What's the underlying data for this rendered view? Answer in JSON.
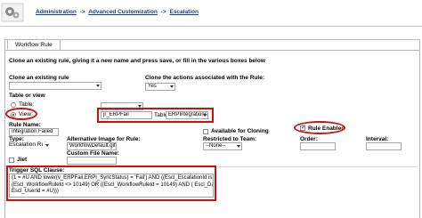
{
  "breadcrumb": {
    "item1": "Administration",
    "sep": "->",
    "item2": "Advanced Customization",
    "item3": "Escalation"
  },
  "tab": {
    "label": "Workflow Rule"
  },
  "form": {
    "clone_intro": "Clone an existing rule, giving it a new name and press save, or fill in the various boxes below",
    "clone_rule_label": "Clone an existing rule",
    "clone_actions_label": "Clone the actions associated with the Rule:",
    "clone_rule_value": "",
    "clone_actions_value": "Yes",
    "table_or_view_label": "Table or view",
    "table_radio_label": "Table:",
    "view_radio_label": "View:",
    "view_value": "jr_ERPFail",
    "table_label2": "Table:",
    "table_value2": "ERPIntegrations",
    "rule_name_label": "Rule Name:",
    "rule_name_value": "Integration Failed",
    "available_for_cloning_label": "Available for Cloning",
    "rule_enabled_label": "Rule Enabled",
    "type_label": "Type:",
    "type_value": "Escalation Rule",
    "alt_image_label": "Alternative Image for Rule:",
    "alt_image_value": "WorkflowDefault.gif",
    "restricted_label": "Restricted to Team:",
    "restricted_value": "--None--",
    "order_label": "Order:",
    "interval_label": "Interval:",
    "custom_file_label": "Custom File Name:",
    "jiet_label": "Jiet",
    "trigger_label": "Trigger SQL Clause:",
    "trigger_value": "(1 = #U AND lower(v_ERPFail.ERPI_SyncStatus) = 'Fail') AND ((Escl_EscalationId is NULL ) OR\n(Escl_WorkflowRuleId <> 10149) OR ((Escl_WorkflowRuleId = 10149) AND ( Escl_DateTime < #T AND\nEscl_UserId = #U)))"
  }
}
